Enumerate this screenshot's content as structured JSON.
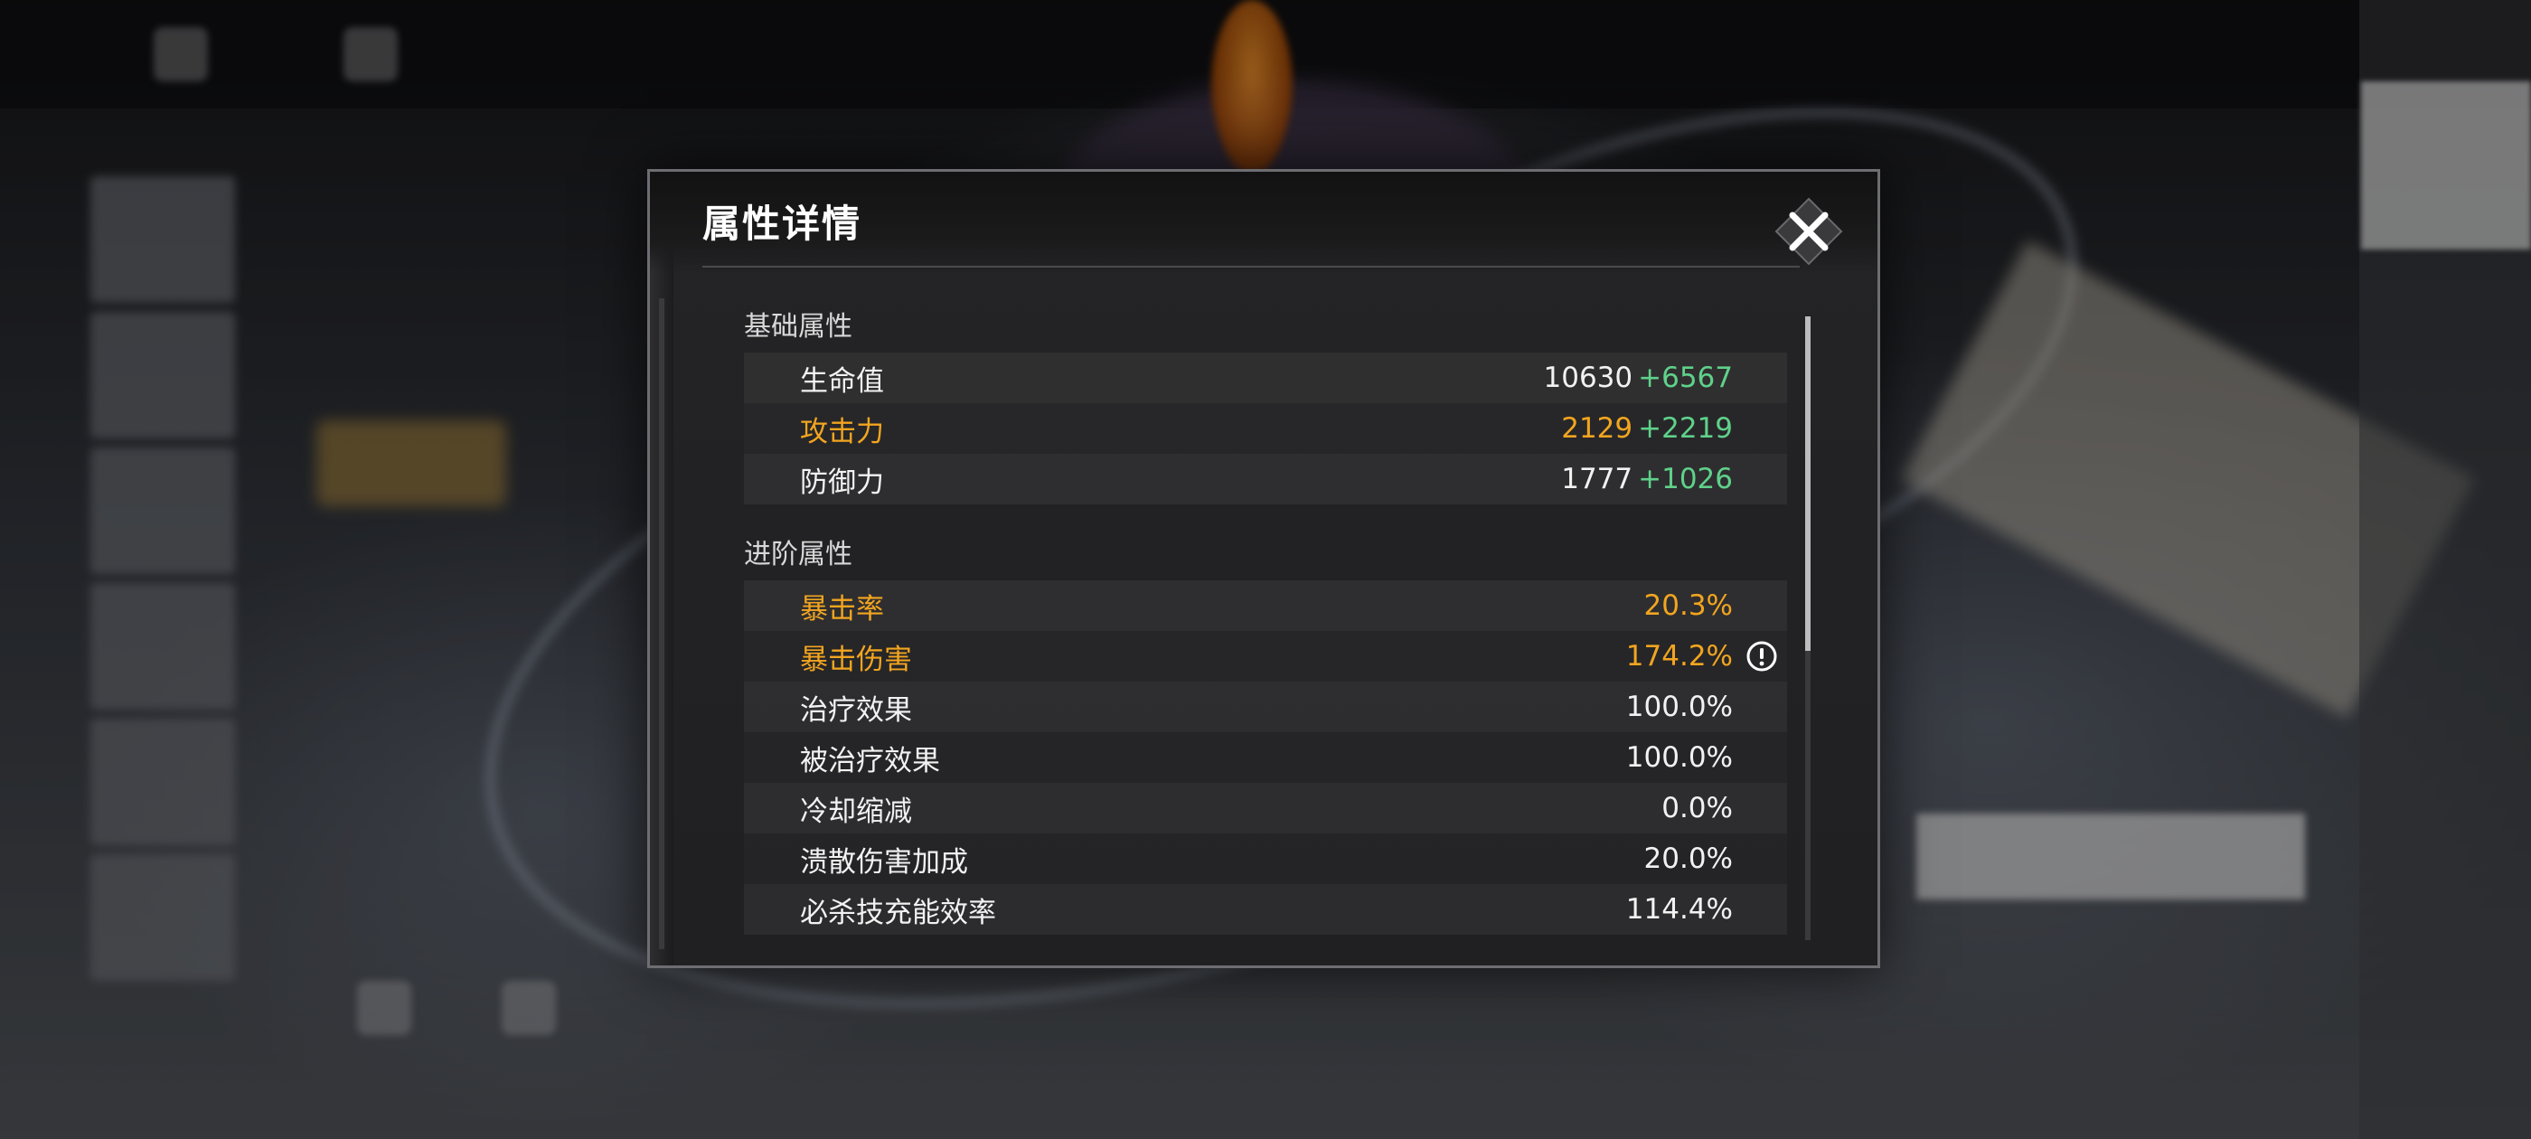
{
  "modal": {
    "title": "属性详情",
    "close_icon": "close-x-icon"
  },
  "sections": [
    {
      "title": "基础属性",
      "rows": [
        {
          "label": "生命值",
          "value": "10630",
          "bonus": "+6567",
          "highlight": false
        },
        {
          "label": "攻击力",
          "value": "2129",
          "bonus": "+2219",
          "highlight": true
        },
        {
          "label": "防御力",
          "value": "1777",
          "bonus": "+1026",
          "highlight": false
        }
      ]
    },
    {
      "title": "进阶属性",
      "rows": [
        {
          "label": "暴击率",
          "value": "20.3%",
          "bonus": "",
          "highlight": true
        },
        {
          "label": "暴击伤害",
          "value": "174.2%",
          "bonus": "",
          "highlight": true,
          "icon": "exclamation-info-icon"
        },
        {
          "label": "治疗效果",
          "value": "100.0%",
          "bonus": "",
          "highlight": false
        },
        {
          "label": "被治疗效果",
          "value": "100.0%",
          "bonus": "",
          "highlight": false
        },
        {
          "label": "冷却缩减",
          "value": "0.0%",
          "bonus": "",
          "highlight": false
        },
        {
          "label": "溃散伤害加成",
          "value": "20.0%",
          "bonus": "",
          "highlight": false
        },
        {
          "label": "必杀技充能效率",
          "value": "114.4%",
          "bonus": "",
          "highlight": false
        }
      ]
    }
  ],
  "colors": {
    "highlight": "#f2a51f",
    "bonus": "#5fd18a",
    "text": "#f2f2f2",
    "panel_bg": "#222224"
  }
}
